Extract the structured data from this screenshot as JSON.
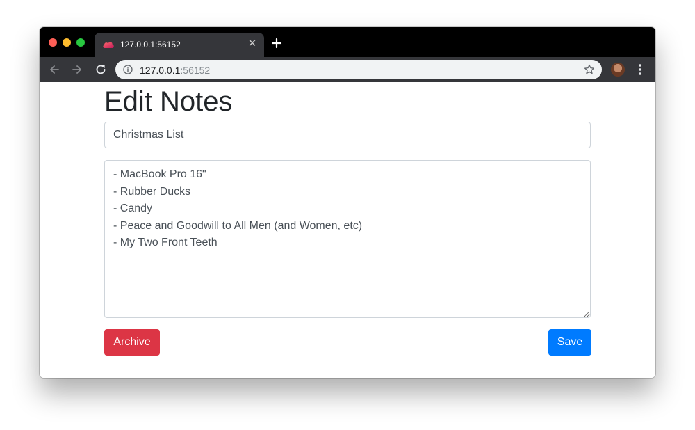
{
  "browser": {
    "tab": {
      "title": "127.0.0.1:56152",
      "close_icon": "close-icon",
      "favicon": "cloud-icon"
    },
    "new_tab_icon": "plus-icon",
    "toolbar": {
      "back_icon": "arrow-left-icon",
      "forward_icon": "arrow-right-icon",
      "reload_icon": "reload-icon",
      "url_host": "127.0.0.1",
      "url_port": ":56152",
      "info_icon": "info-icon",
      "bookmark_icon": "star-icon",
      "menu_icon": "kebab-menu-icon"
    }
  },
  "page": {
    "heading": "Edit Notes",
    "title_value": "Christmas List",
    "body_value": "- MacBook Pro 16\"\n- Rubber Ducks\n- Candy\n- Peace and Goodwill to All Men (and Women, etc)\n- My Two Front Teeth",
    "archive_label": "Archive",
    "save_label": "Save"
  },
  "colors": {
    "archive": "#dc3545",
    "save": "#007bff",
    "tab_bar": "#000000",
    "toolbar": "#35363a"
  }
}
